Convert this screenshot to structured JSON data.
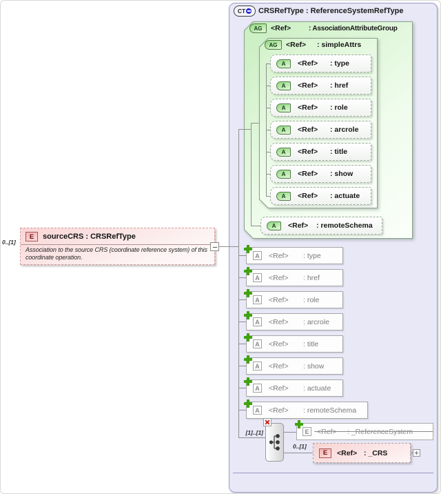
{
  "source_element": {
    "cardinality": "0..[1]",
    "icon_letter": "E",
    "title": "sourceCRS : CRSRefType",
    "description": "Association to the source CRS (coordinate reference system) of this coordinate operation."
  },
  "complex_type": {
    "icon_label": "CT",
    "title": "CRSRefType : ReferenceSystemRefType",
    "ref_label": "<Ref>",
    "ag_icon_label": "AG",
    "attr_icon_letter": "A",
    "elem_icon_letter": "E",
    "attribute_group": {
      "name": ": AssociationAttributeGroup",
      "simple_attrs": {
        "name": ": simpleAttrs",
        "attributes": [
          ": type",
          ": href",
          ": role",
          ": arcrole",
          ": title",
          ": show",
          ": actuate"
        ]
      },
      "remote_schema": ": remoteSchema"
    },
    "local_attributes": [
      ": type",
      ": href",
      ": role",
      ": arcrole",
      ": title",
      ": show",
      ": actuate",
      ": remoteSchema"
    ],
    "choice": {
      "cardinality": "[1]..[1]",
      "reference_system": {
        "name": ": _ReferenceSystem"
      },
      "crs": {
        "name": ": _CRS",
        "cardinality": "0..[1]"
      }
    }
  }
}
